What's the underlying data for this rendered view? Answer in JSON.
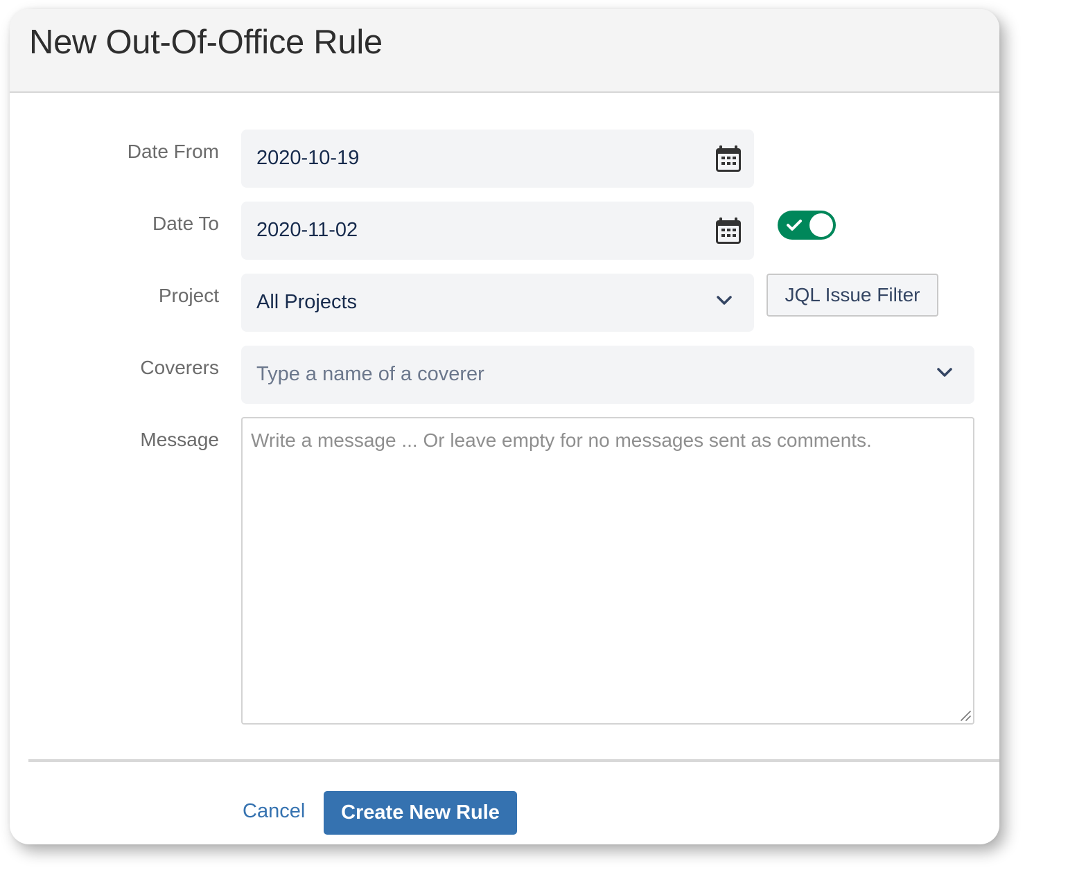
{
  "dialog": {
    "title": "New Out-Of-Office Rule"
  },
  "form": {
    "date_from": {
      "label": "Date From",
      "value": "2020-10-19",
      "icon": "calendar-icon"
    },
    "date_to": {
      "label": "Date To",
      "value": "2020-11-02",
      "icon": "calendar-icon",
      "toggle_enabled": true,
      "toggle_icon": "check-icon"
    },
    "project": {
      "label": "Project",
      "value": "All Projects",
      "icon": "chevron-down-icon",
      "jql_button_label": "JQL Issue Filter"
    },
    "coverers": {
      "label": "Coverers",
      "placeholder": "Type a name of a coverer",
      "icon": "chevron-down-icon"
    },
    "message": {
      "label": "Message",
      "placeholder": "Write a message ... Or leave empty for no messages sent as comments.",
      "value": ""
    }
  },
  "footer": {
    "cancel_label": "Cancel",
    "submit_label": "Create New Rule"
  },
  "colors": {
    "accent": "#3572b0",
    "toggle_on": "#00875a",
    "input_bg": "#f3f4f6",
    "header_bg": "#f4f4f4",
    "value_text": "#172b4d",
    "label_text": "#6b6b6b"
  }
}
